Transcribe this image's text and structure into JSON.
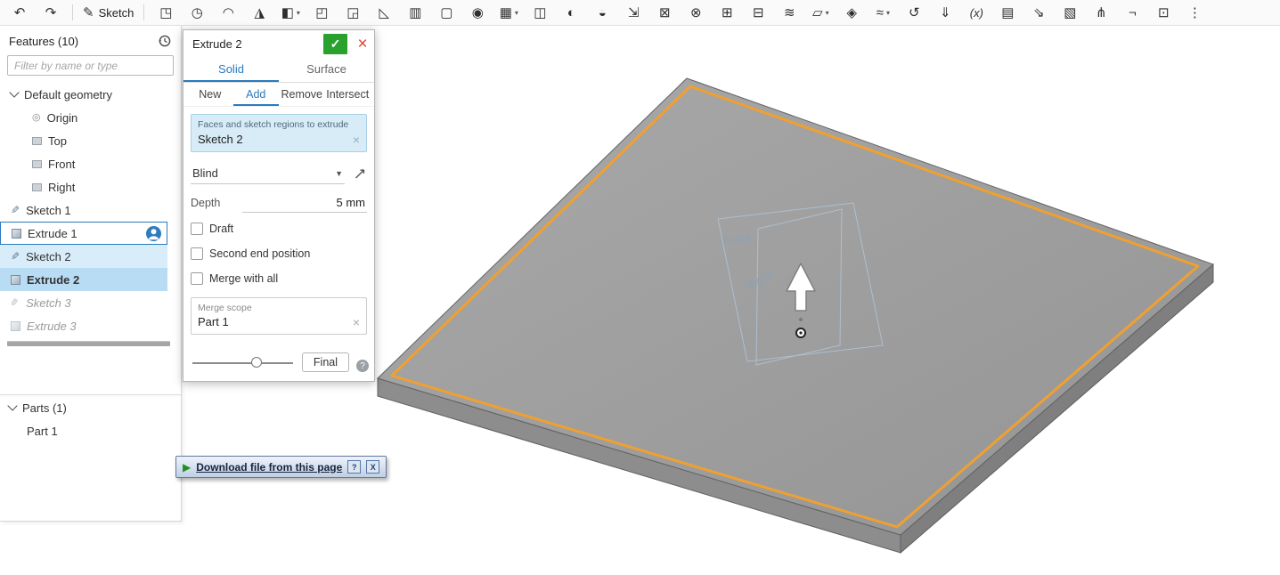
{
  "colors": {
    "accent_blue": "#2a7bbd",
    "selection_blue": "#b9dcf5",
    "accept_green": "#2aa12e",
    "cancel_red": "#e03c31",
    "highlight_orange": "#f0a030"
  },
  "toolbar": {
    "items": [
      {
        "name": "undo-icon",
        "glyph": "↶"
      },
      {
        "name": "redo-icon",
        "glyph": "↷"
      },
      {
        "type": "divider"
      },
      {
        "name": "sketch-button",
        "glyph": "✎",
        "label": "Sketch"
      },
      {
        "type": "divider"
      },
      {
        "name": "extrude-icon",
        "glyph": "◳"
      },
      {
        "name": "revolve-icon",
        "glyph": "◷"
      },
      {
        "name": "sweep-icon",
        "glyph": "◠"
      },
      {
        "name": "loft-icon",
        "glyph": "◮"
      },
      {
        "name": "thicken-icon",
        "glyph": "◧",
        "dropdown": true
      },
      {
        "name": "fillet-icon",
        "glyph": "◰"
      },
      {
        "name": "chamfer-icon",
        "glyph": "◲"
      },
      {
        "name": "draft-icon",
        "glyph": "◺"
      },
      {
        "name": "rib-icon",
        "glyph": "▥"
      },
      {
        "name": "shell-icon",
        "glyph": "▢"
      },
      {
        "name": "hole-icon",
        "glyph": "◉"
      },
      {
        "name": "linear-pattern-icon",
        "glyph": "▦",
        "dropdown": true
      },
      {
        "name": "mirror-icon",
        "glyph": "◫"
      },
      {
        "name": "boolean-icon",
        "glyph": "◐"
      },
      {
        "name": "split-icon",
        "glyph": "◒"
      },
      {
        "name": "transform-icon",
        "glyph": "⇲"
      },
      {
        "name": "delete-part-icon",
        "glyph": "⊠"
      },
      {
        "name": "delete-face-icon",
        "glyph": "⊗"
      },
      {
        "name": "move-face-icon",
        "glyph": "⊞"
      },
      {
        "name": "replace-face-icon",
        "glyph": "⊟"
      },
      {
        "name": "offset-surface-icon",
        "glyph": "≋"
      },
      {
        "name": "plane-icon",
        "glyph": "▱",
        "dropdown": true
      },
      {
        "name": "surface-icon",
        "glyph": "◈"
      },
      {
        "name": "curve-icon",
        "glyph": "≈",
        "dropdown": true
      },
      {
        "name": "helix-icon",
        "glyph": "↺"
      },
      {
        "name": "import-icon",
        "glyph": "⇓"
      },
      {
        "name": "variables-icon",
        "glyph": "(x)"
      },
      {
        "name": "sheet-metal-icon",
        "glyph": "▤"
      },
      {
        "name": "flatten-icon",
        "glyph": "⇘"
      },
      {
        "name": "table-icon",
        "glyph": "▧"
      },
      {
        "name": "routing-icon",
        "glyph": "⋔"
      },
      {
        "name": "frame-icon",
        "glyph": "¬"
      },
      {
        "name": "custom-feature-icon",
        "glyph": "⊡"
      },
      {
        "name": "more-tools-icon",
        "glyph": "⋮"
      }
    ]
  },
  "features": {
    "title": "Features (10)",
    "filter_placeholder": "Filter by name or type",
    "tree": [
      {
        "label": "Default geometry"
      },
      {
        "label": "Origin"
      },
      {
        "label": "Top"
      },
      {
        "label": "Front"
      },
      {
        "label": "Right"
      },
      {
        "label": "Sketch 1"
      },
      {
        "label": "Extrude 1"
      },
      {
        "label": "Sketch 2"
      },
      {
        "label": "Extrude 2"
      },
      {
        "label": "Sketch 3"
      },
      {
        "label": "Extrude 3"
      }
    ],
    "parts_title": "Parts (1)",
    "parts": [
      {
        "label": "Part 1"
      }
    ]
  },
  "dialog": {
    "title": "Extrude 2",
    "accept_label": "✓",
    "cancel_label": "×",
    "tabs": [
      {
        "label": "Solid"
      },
      {
        "label": "Surface"
      }
    ],
    "active_tab": "Solid",
    "mode_tabs": [
      {
        "label": "New"
      },
      {
        "label": "Add"
      },
      {
        "label": "Remove"
      },
      {
        "label": "Intersect"
      }
    ],
    "active_mode": "Add",
    "selection": {
      "label": "Faces and sketch regions to extrude",
      "value": "Sketch 2",
      "remove_label": "×"
    },
    "end_condition": "Blind",
    "depth": {
      "label": "Depth",
      "value": "5 mm"
    },
    "checkboxes": [
      {
        "label": "Draft",
        "checked": false
      },
      {
        "label": "Second end position",
        "checked": false
      },
      {
        "label": "Merge with all",
        "checked": false
      }
    ],
    "merge_scope": {
      "label": "Merge scope",
      "value": "Part 1",
      "remove_label": "×"
    },
    "final_button_label": "Final",
    "help_label": "?"
  },
  "viewport": {
    "front_plane_label": "Front",
    "right_plane_label": "Right"
  },
  "download_banner": {
    "play_glyph": "▶",
    "text": "Download file from this page",
    "help_label": "?",
    "close_label": "X"
  }
}
